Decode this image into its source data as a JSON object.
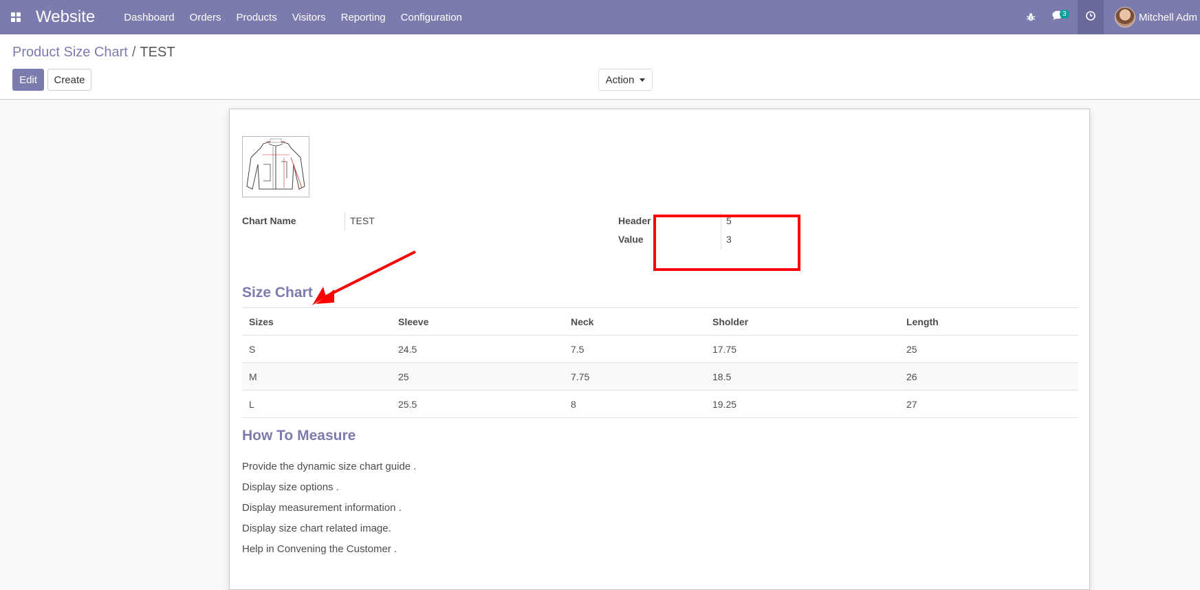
{
  "navbar": {
    "brand": "Website",
    "menu": [
      "Dashboard",
      "Orders",
      "Products",
      "Visitors",
      "Reporting",
      "Configuration"
    ],
    "chat_count": "3",
    "user_name": "Mitchell Adm",
    "color": "#7c7bad"
  },
  "breadcrumb": {
    "parent": "Product Size Chart",
    "separator": "/",
    "current": "TEST"
  },
  "buttons": {
    "edit": "Edit",
    "create": "Create",
    "action": "Action"
  },
  "form": {
    "chart_name_label": "Chart Name",
    "chart_name_value": "TEST",
    "header_label": "Header",
    "header_value": "5",
    "value_label": "Value",
    "value_value": "3"
  },
  "size_chart": {
    "title": "Size Chart",
    "columns": [
      "Sizes",
      "Sleeve",
      "Neck",
      "Sholder",
      "Length"
    ],
    "rows": [
      [
        "S",
        "24.5",
        "7.5",
        "17.75",
        "25"
      ],
      [
        "M",
        "25",
        "7.75",
        "18.5",
        "26"
      ],
      [
        "L",
        "25.5",
        "8",
        "19.25",
        "27"
      ]
    ]
  },
  "how_to_measure": {
    "title": "How To Measure",
    "items": [
      "Provide the dynamic size chart guide .",
      "Display size options .",
      "Display measurement information .",
      "Display size chart related image.",
      "Help in Convening the Customer ."
    ]
  },
  "icons": {
    "apps": "apps-grid-icon",
    "bug": "bug-icon",
    "chat": "chat-icon",
    "clock": "clock-icon",
    "annotation_arrow": "red-arrow",
    "highlight_color": "#ff0000"
  }
}
